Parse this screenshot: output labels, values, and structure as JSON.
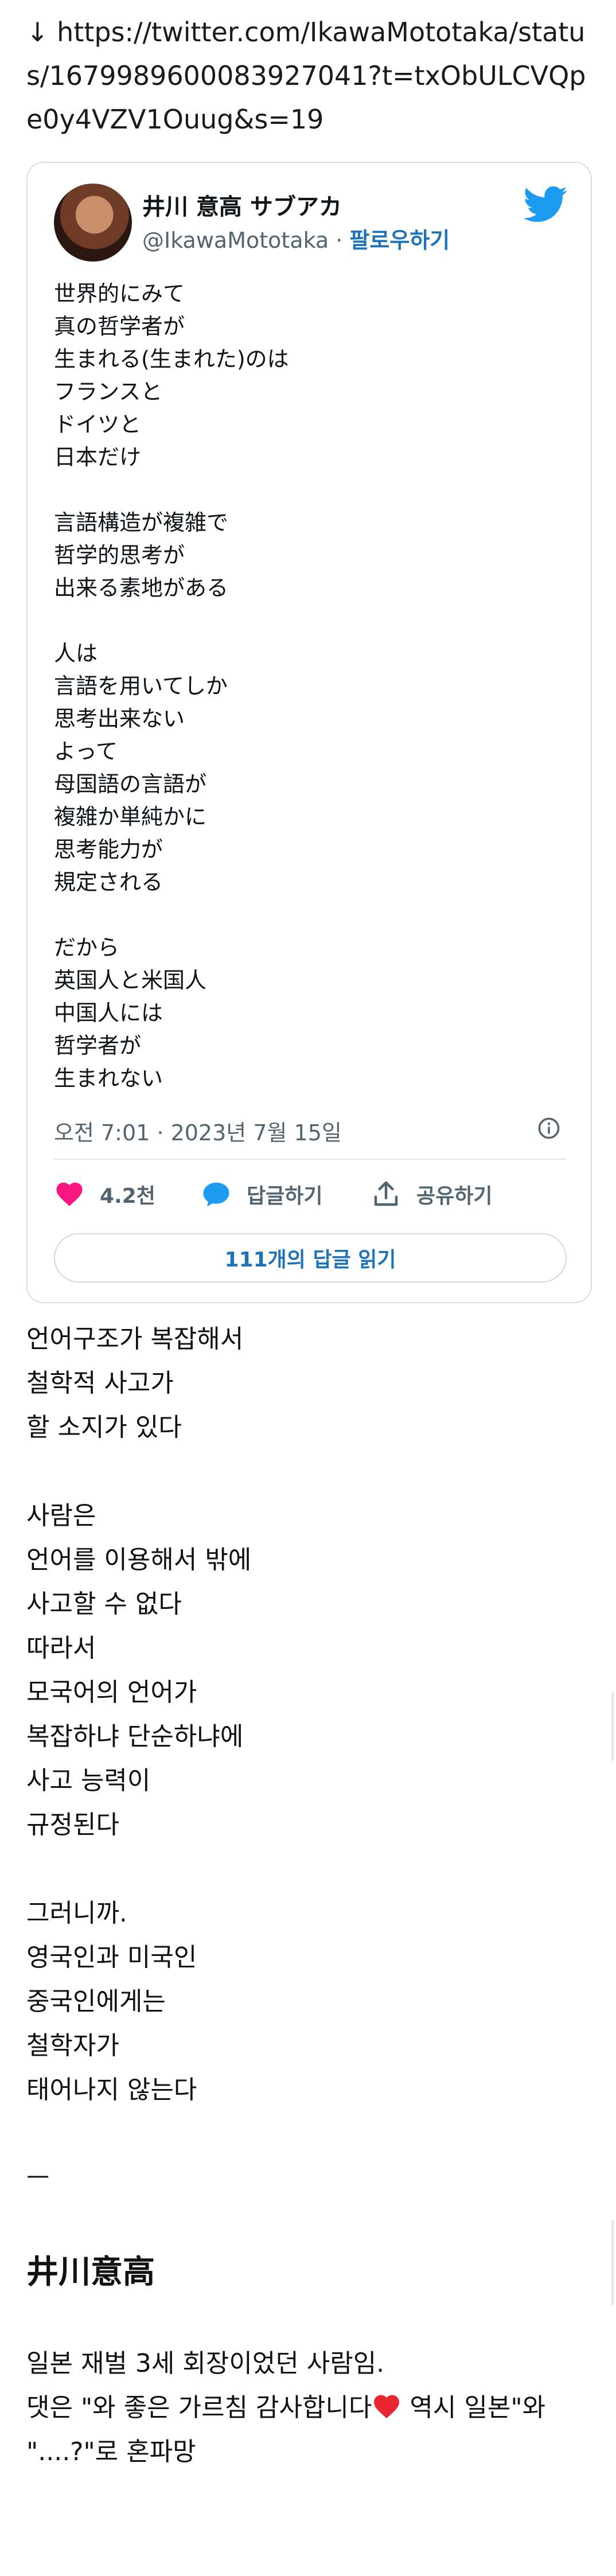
{
  "link_text": "↓ https://twitter.com/IkawaMototaka/status/1679989600083927041?t=txObULCVQpe0y4VZV1Ouug&s=19",
  "tweet": {
    "author_name": "井川 意高 サブアカ",
    "author_handle": "@IkawaMototaka",
    "separator": " · ",
    "follow_label": "팔로우하기",
    "text": "世界的にみて\n真の哲学者が\n生まれる(生まれた)のは\nフランスと\nドイツと\n日本だけ\n\n言語構造が複雑で\n哲学的思考が\n出来る素地がある\n\n人は\n言語を用いてしか\n思考出来ない\nよって\n母国語の言語が\n複雑か単純かに\n思考能力が\n規定される\n\nだから\n英国人と米国人\n中国人には\n哲学者が\n生まれない",
    "date": "오전 7:01 · 2023년 7월 15일",
    "likes_label": "4.2천",
    "reply_label": "답글하기",
    "share_label": "공유하기",
    "read_replies_label": "111개의 답글 읽기"
  },
  "korean_text": "언어구조가 복잡해서\n철학적 사고가\n할 소지가 있다\n\n사람은\n언어를 이용해서 밖에\n사고할 수 없다\n따라서\n모국어의 언어가\n복잡하냐 단순하냐에\n사고 능력이\n규정된다\n\n그러니까.\n영국인과 미국인\n중국인에게는\n철학자가\n태어나지 않는다\n\nㅡ",
  "heading": "井川意高",
  "outro_line1": "일본 재벌 3세 회장이었던 사람임.",
  "outro_line2a": "댓은 \"와 좋은 가르침 감사합니다",
  "outro_line2b": " 역시 일본\"와",
  "outro_line3": "\"....?\"로 혼파망",
  "colors": {
    "twitter_blue": "#1d9bf0",
    "like_pink": "#f91880",
    "link_blue": "#1d72b8",
    "muted": "#536471"
  }
}
